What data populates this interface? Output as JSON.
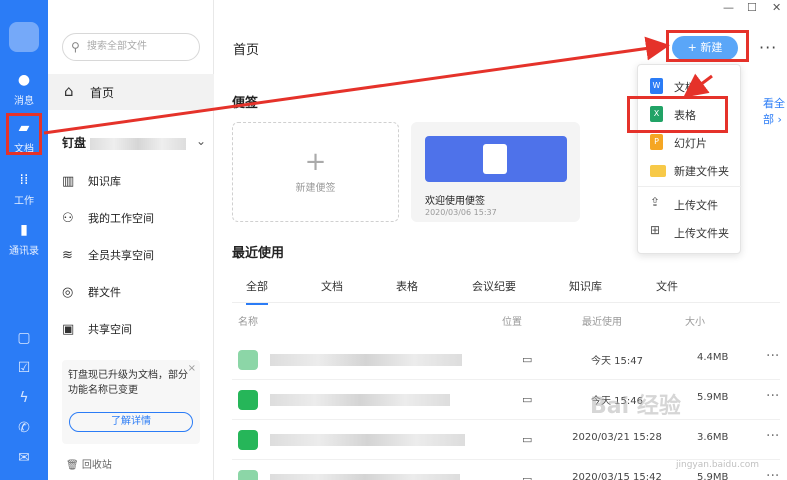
{
  "rail": {
    "items": [
      {
        "label": "消息",
        "icon": "chat-icon"
      },
      {
        "label": "文档",
        "icon": "folder-icon"
      },
      {
        "label": "工作",
        "icon": "grid-icon"
      },
      {
        "label": "通讯录",
        "icon": "contacts-icon"
      }
    ]
  },
  "sidebar": {
    "search_placeholder": "搜索全部文件",
    "home_label": "首页",
    "drive_label": "钉盘",
    "nav": [
      "知识库",
      "我的工作空间",
      "全员共享空间",
      "群文件",
      "共享空间"
    ],
    "notice_text": "钉盘现已升级为文档，部分功能名称已变更",
    "notice_close": "×",
    "notice_button": "了解详情",
    "trash_label": "回收站"
  },
  "header": {
    "title": "首页",
    "new_button": "+ 新建",
    "more": "···"
  },
  "notes": {
    "title": "便签",
    "see_all": "看全部 ›",
    "new_note": "新建便签",
    "welcome_title": "欢迎使用便签",
    "welcome_date": "2020/03/06 15:37"
  },
  "recent": {
    "title": "最近使用",
    "tabs": [
      "全部",
      "文档",
      "表格",
      "会议纪要",
      "知识库",
      "文件"
    ],
    "columns": {
      "name": "名称",
      "location": "位置",
      "last_used": "最近使用",
      "size": "大小"
    },
    "rows": [
      {
        "time": "今天 15:47",
        "size": "4.4MB"
      },
      {
        "time": "今天 15:46",
        "size": "5.9MB"
      },
      {
        "time": "2020/03/21 15:28",
        "size": "3.6MB"
      },
      {
        "time": "2020/03/15 15:42",
        "size": "5.9MB"
      }
    ]
  },
  "menu": {
    "items": [
      {
        "label": "文档",
        "icon": "W",
        "color": "#2b7cf6"
      },
      {
        "label": "表格",
        "icon": "X",
        "color": "#21a366"
      },
      {
        "label": "幻灯片",
        "icon": "P",
        "color": "#f5a623"
      },
      {
        "label": "新建文件夹",
        "icon": "folder-icon",
        "color": "#f7c948"
      },
      {
        "label": "上传文件",
        "icon": "upload-icon"
      },
      {
        "label": "上传文件夹",
        "icon": "upload-folder-icon"
      }
    ]
  },
  "watermark": {
    "main": "Bai 经验",
    "sub": "jingyan.baidu.com"
  },
  "colors": {
    "accent": "#2b7cf6",
    "highlight": "#e5322a",
    "excel": "#21a366"
  }
}
